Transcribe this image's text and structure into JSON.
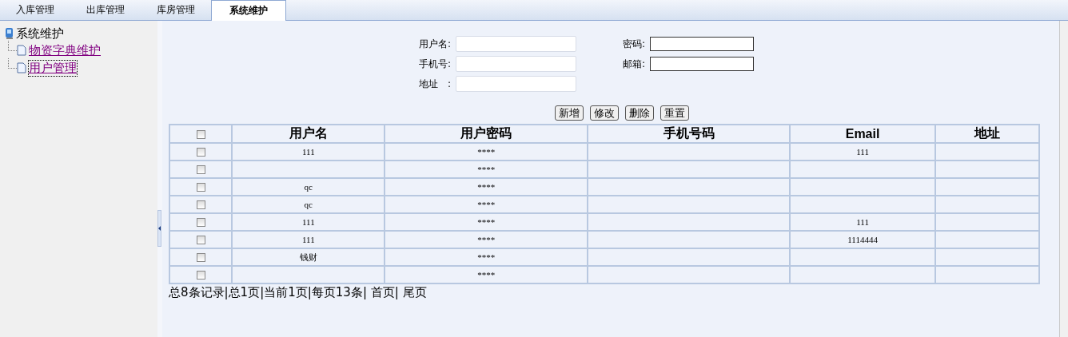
{
  "tabs": [
    {
      "label": "入库管理",
      "selected": false
    },
    {
      "label": "出库管理",
      "selected": false
    },
    {
      "label": "库房管理",
      "selected": false
    },
    {
      "label": "系统维护",
      "selected": true
    }
  ],
  "sidebar": {
    "title": "系统维护",
    "items": [
      {
        "label": "物资字典维护",
        "selected": false
      },
      {
        "label": "用户管理",
        "selected": true
      }
    ]
  },
  "form": {
    "fields": [
      {
        "label": "用户名:"
      },
      {
        "label": "密码:"
      },
      {
        "label": "手机号:"
      },
      {
        "label": "邮箱:"
      },
      {
        "label": "地址　:"
      }
    ],
    "buttons": [
      "新增",
      "修改",
      "删除",
      "重置"
    ]
  },
  "table": {
    "select_all_checked": false,
    "columns": [
      "用户名",
      "用户密码",
      "手机号码",
      "Email",
      "地址"
    ],
    "rows": [
      {
        "checked": false,
        "cells": [
          "111",
          "****",
          null,
          "111",
          null
        ]
      },
      {
        "checked": false,
        "cells": [
          null,
          "****",
          null,
          null,
          null
        ]
      },
      {
        "checked": false,
        "cells": [
          "qc",
          "****",
          null,
          null,
          null
        ]
      },
      {
        "checked": false,
        "cells": [
          "qc",
          "****",
          null,
          null,
          null
        ]
      },
      {
        "checked": false,
        "cells": [
          "111",
          "****",
          null,
          "111",
          null
        ]
      },
      {
        "checked": false,
        "cells": [
          "111",
          "****",
          null,
          "1114444",
          null
        ]
      },
      {
        "checked": false,
        "cells": [
          "钱财",
          "****",
          null,
          null,
          null
        ]
      },
      {
        "checked": false,
        "cells": [
          null,
          "****",
          null,
          null,
          null
        ]
      }
    ]
  },
  "pager": "总8条记录|总1页|当前1页|每页13条| 首页| 尾页"
}
